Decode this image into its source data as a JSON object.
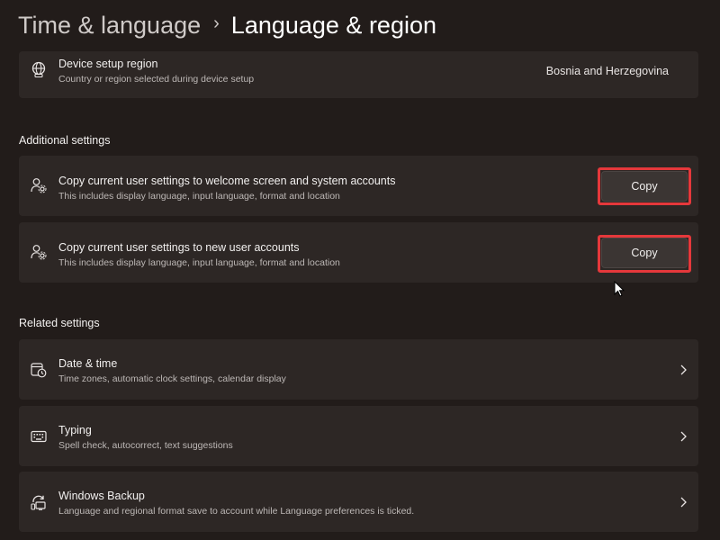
{
  "breadcrumb": {
    "parent": "Time & language",
    "separator": "›",
    "current": "Language & region"
  },
  "device_region": {
    "icon": "globe-icon",
    "title": "Device setup region",
    "subtitle": "Country or region selected during device setup",
    "value": "Bosnia and Herzegovina"
  },
  "additional_settings": {
    "heading": "Additional settings",
    "items": [
      {
        "icon": "user-settings-icon",
        "title": "Copy current user settings to welcome screen and system accounts",
        "subtitle": "This includes display language, input language, format and location",
        "button_label": "Copy"
      },
      {
        "icon": "user-settings-icon",
        "title": "Copy current user settings to new user accounts",
        "subtitle": "This includes display language, input language, format and location",
        "button_label": "Copy"
      }
    ]
  },
  "related_settings": {
    "heading": "Related settings",
    "items": [
      {
        "icon": "clock-calendar-icon",
        "title": "Date & time",
        "subtitle": "Time zones, automatic clock settings, calendar display"
      },
      {
        "icon": "keyboard-icon",
        "title": "Typing",
        "subtitle": "Spell check, autocorrect, text suggestions"
      },
      {
        "icon": "backup-icon",
        "title": "Windows Backup",
        "subtitle": "Language and regional format save to account while Language preferences is ticked."
      }
    ]
  },
  "colors": {
    "background": "#221c1a",
    "card": "#2d2725",
    "highlight": "#e5383b",
    "button": "#3b3533"
  }
}
